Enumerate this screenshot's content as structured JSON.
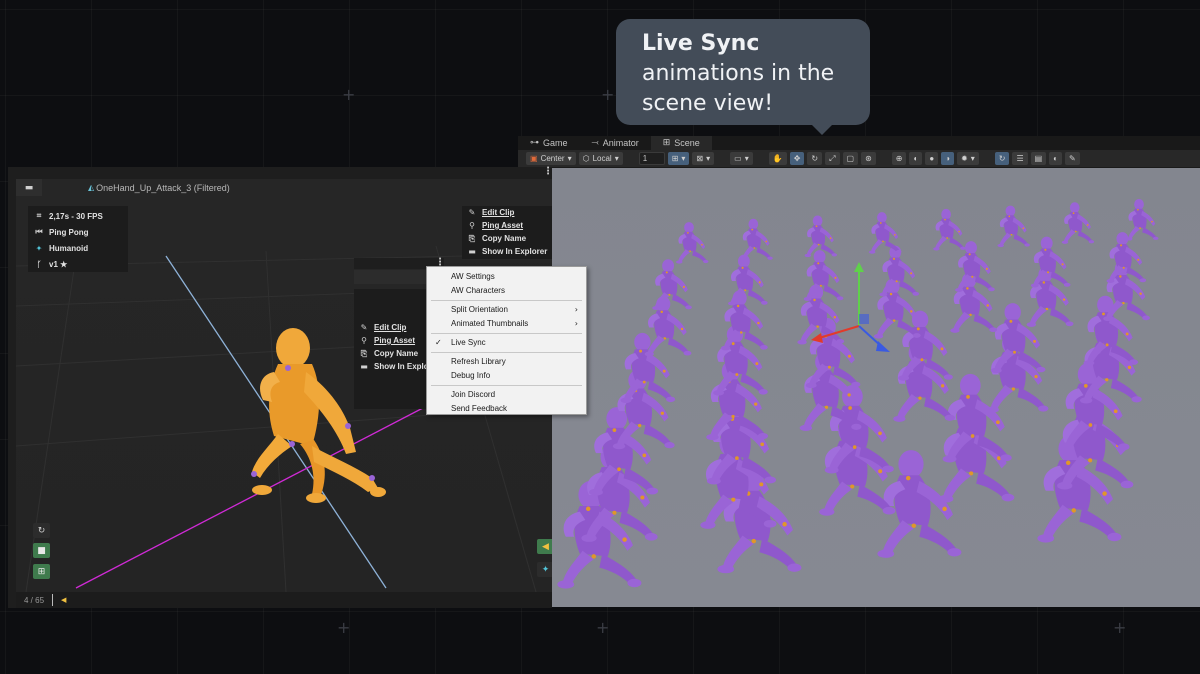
{
  "callout": {
    "title": "Live Sync",
    "body_line1": "animations in the",
    "body_line2": "scene view!"
  },
  "unity": {
    "tabs": [
      {
        "label": "Game",
        "icon": "gamepad-icon"
      },
      {
        "label": "Animator",
        "icon": "animator-icon"
      },
      {
        "label": "Scene",
        "icon": "grid-icon"
      }
    ],
    "active_tab": "Scene",
    "toolbar": {
      "pivot_label": "Center",
      "space_label": "Local",
      "snap_value": "1"
    }
  },
  "animation_window": {
    "clip_title": "OneHand_Up_Attack_3 (Filtered)",
    "info": {
      "duration_fps": "2,17s - 30 FPS",
      "loop_mode": "Ping Pong",
      "rig_type": "Humanoid",
      "version": "v1 ★"
    },
    "context_top": {
      "items": [
        "Edit Clip",
        "Ping Asset",
        "Copy Name",
        "Show In Explorer"
      ]
    },
    "context_mid": {
      "items": [
        "Edit Clip",
        "Ping Asset",
        "Copy Name",
        "Show In Explorer"
      ]
    },
    "frame_counter": "4 / 65",
    "menu": {
      "group1": [
        "AW Settings",
        "AW Characters"
      ],
      "group2": [
        {
          "label": "Split Orientation",
          "has_submenu": true
        },
        {
          "label": "Animated Thumbnails",
          "has_submenu": true
        }
      ],
      "group3": [
        {
          "label": "Live Sync",
          "checked": true
        }
      ],
      "group4": [
        "Refresh Library",
        "Debug Info"
      ],
      "group5": [
        "Join Discord",
        "Send Feedback"
      ]
    }
  },
  "colors": {
    "background": "#0d0e11",
    "callout": "#434c58",
    "scene_bg": "#858891",
    "character_orange": "#f0a83a",
    "character_purple": "#9a64d6",
    "accent_green": "#3f7b4d",
    "axis_magenta": "#d02ad6",
    "axis_blue": "#8eb2d8"
  }
}
